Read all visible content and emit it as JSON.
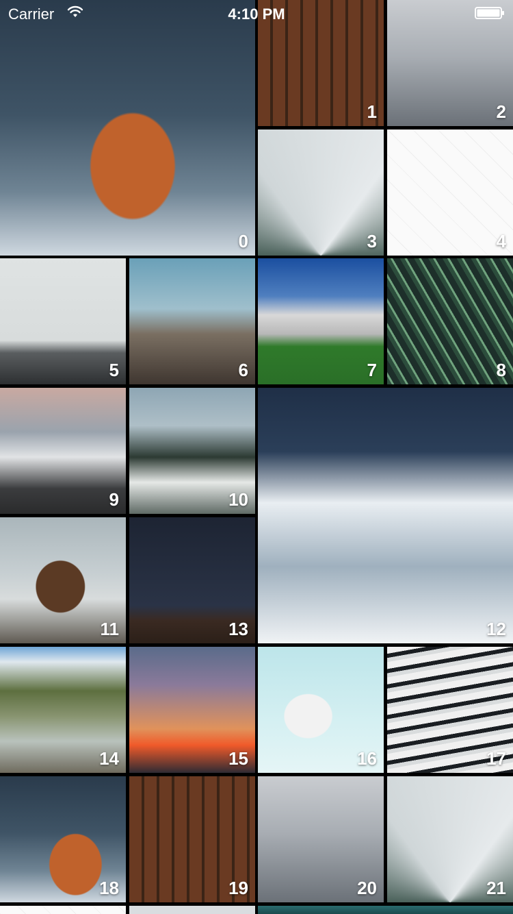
{
  "status_bar": {
    "carrier": "Carrier",
    "time": "4:10 PM",
    "wifi_icon": "wifi-icon",
    "battery_icon": "battery-icon"
  },
  "photos": [
    {
      "label": "0"
    },
    {
      "label": "1"
    },
    {
      "label": "2"
    },
    {
      "label": "3"
    },
    {
      "label": "4"
    },
    {
      "label": "5"
    },
    {
      "label": "6"
    },
    {
      "label": "7"
    },
    {
      "label": "8"
    },
    {
      "label": "9"
    },
    {
      "label": "10"
    },
    {
      "label": "11"
    },
    {
      "label": "12"
    },
    {
      "label": "13"
    },
    {
      "label": "14"
    },
    {
      "label": "15"
    },
    {
      "label": "16"
    },
    {
      "label": "17"
    },
    {
      "label": "18"
    },
    {
      "label": "19"
    },
    {
      "label": "20"
    },
    {
      "label": "21"
    },
    {
      "label": ""
    },
    {
      "label": ""
    },
    {
      "label": ""
    }
  ]
}
